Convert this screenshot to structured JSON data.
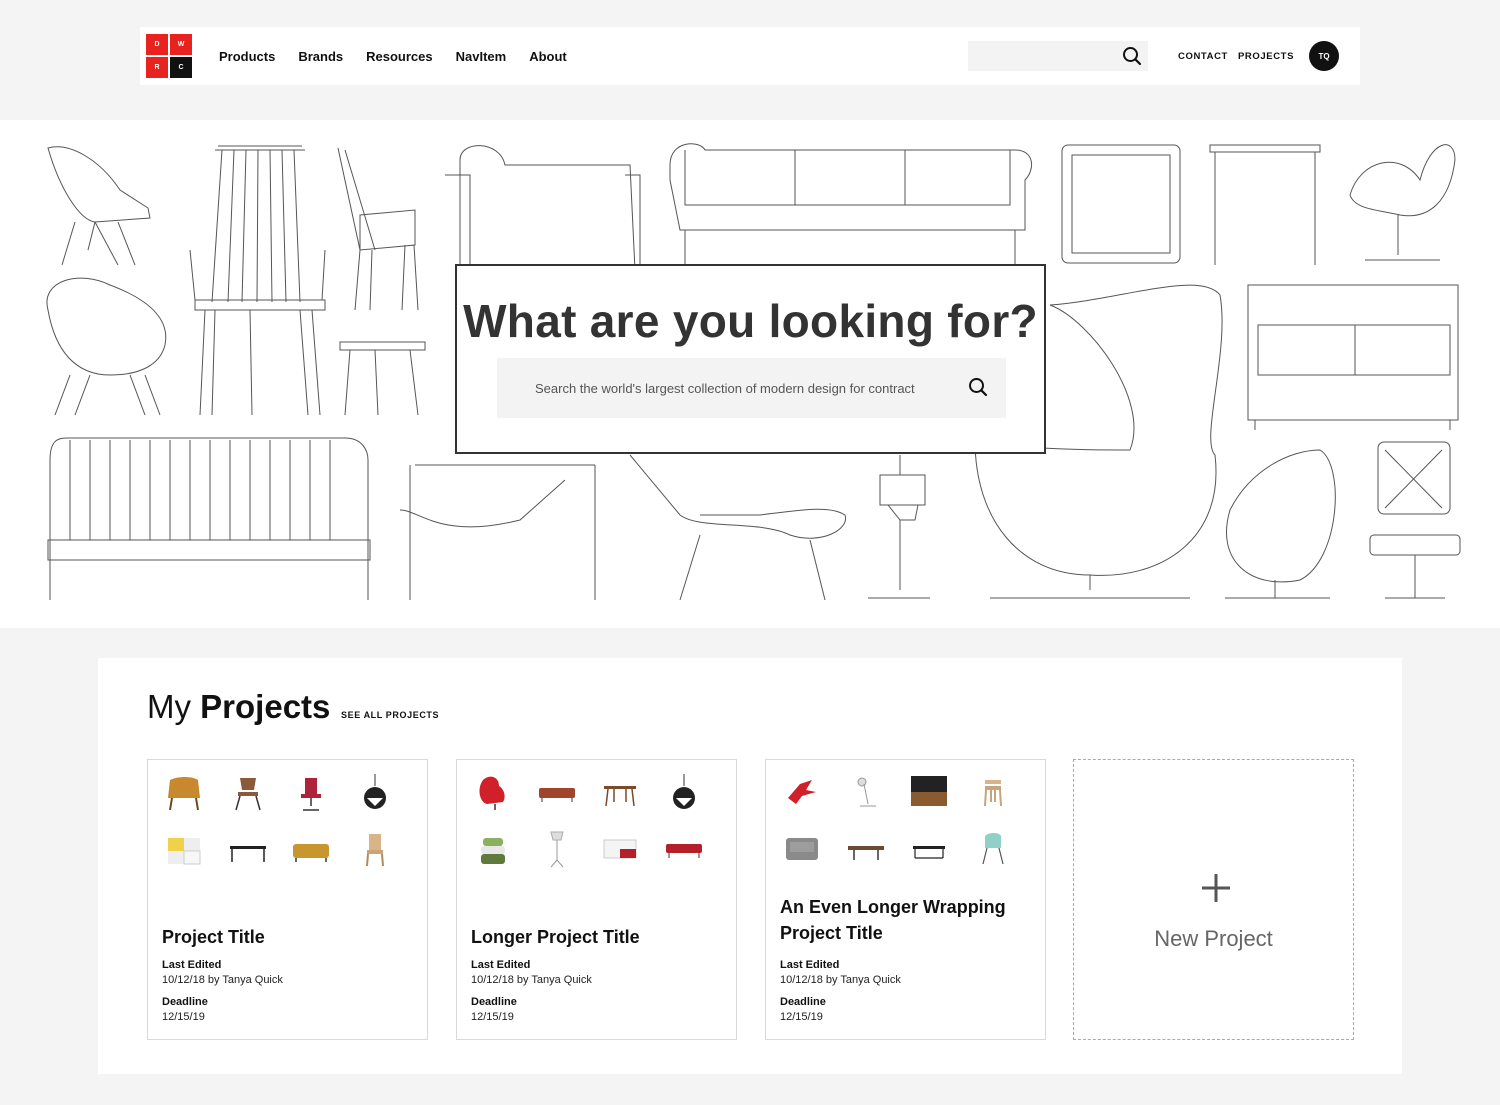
{
  "logo": {
    "letters": [
      "D",
      "W",
      "R",
      "C"
    ]
  },
  "nav": {
    "items": [
      "Products",
      "Brands",
      "Resources",
      "NavItem",
      "About"
    ]
  },
  "header": {
    "contact_label": "CONTACT",
    "projects_label": "PROJECTS",
    "avatar_initials": "TQ",
    "search_icon": "search-icon"
  },
  "hero": {
    "title": "What are you looking for?",
    "search_placeholder": "Search the world's largest collection of modern design for contract",
    "search_icon": "search-icon"
  },
  "projects": {
    "title_light": "My",
    "title_bold": "Projects",
    "see_all_label": "SEE ALL PROJECTS",
    "cards": [
      {
        "title": "Project Title",
        "last_edited_label": "Last Edited",
        "last_edited_value": "10/12/18 by Tanya Quick",
        "deadline_label": "Deadline",
        "deadline_value": "12/15/19"
      },
      {
        "title": "Longer Project Title",
        "last_edited_label": "Last Edited",
        "last_edited_value": "10/12/18 by Tanya Quick",
        "deadline_label": "Deadline",
        "deadline_value": "12/15/19"
      },
      {
        "title": "An Even Longer Wrapping Project Title",
        "last_edited_label": "Last Edited",
        "last_edited_value": "10/12/18 by Tanya Quick",
        "deadline_label": "Deadline",
        "deadline_value": "12/15/19"
      }
    ],
    "new_project_label": "New Project"
  },
  "colors": {
    "brand_red": "#e8231f",
    "brand_black": "#111111",
    "panel_bg": "#f4f4f4"
  }
}
